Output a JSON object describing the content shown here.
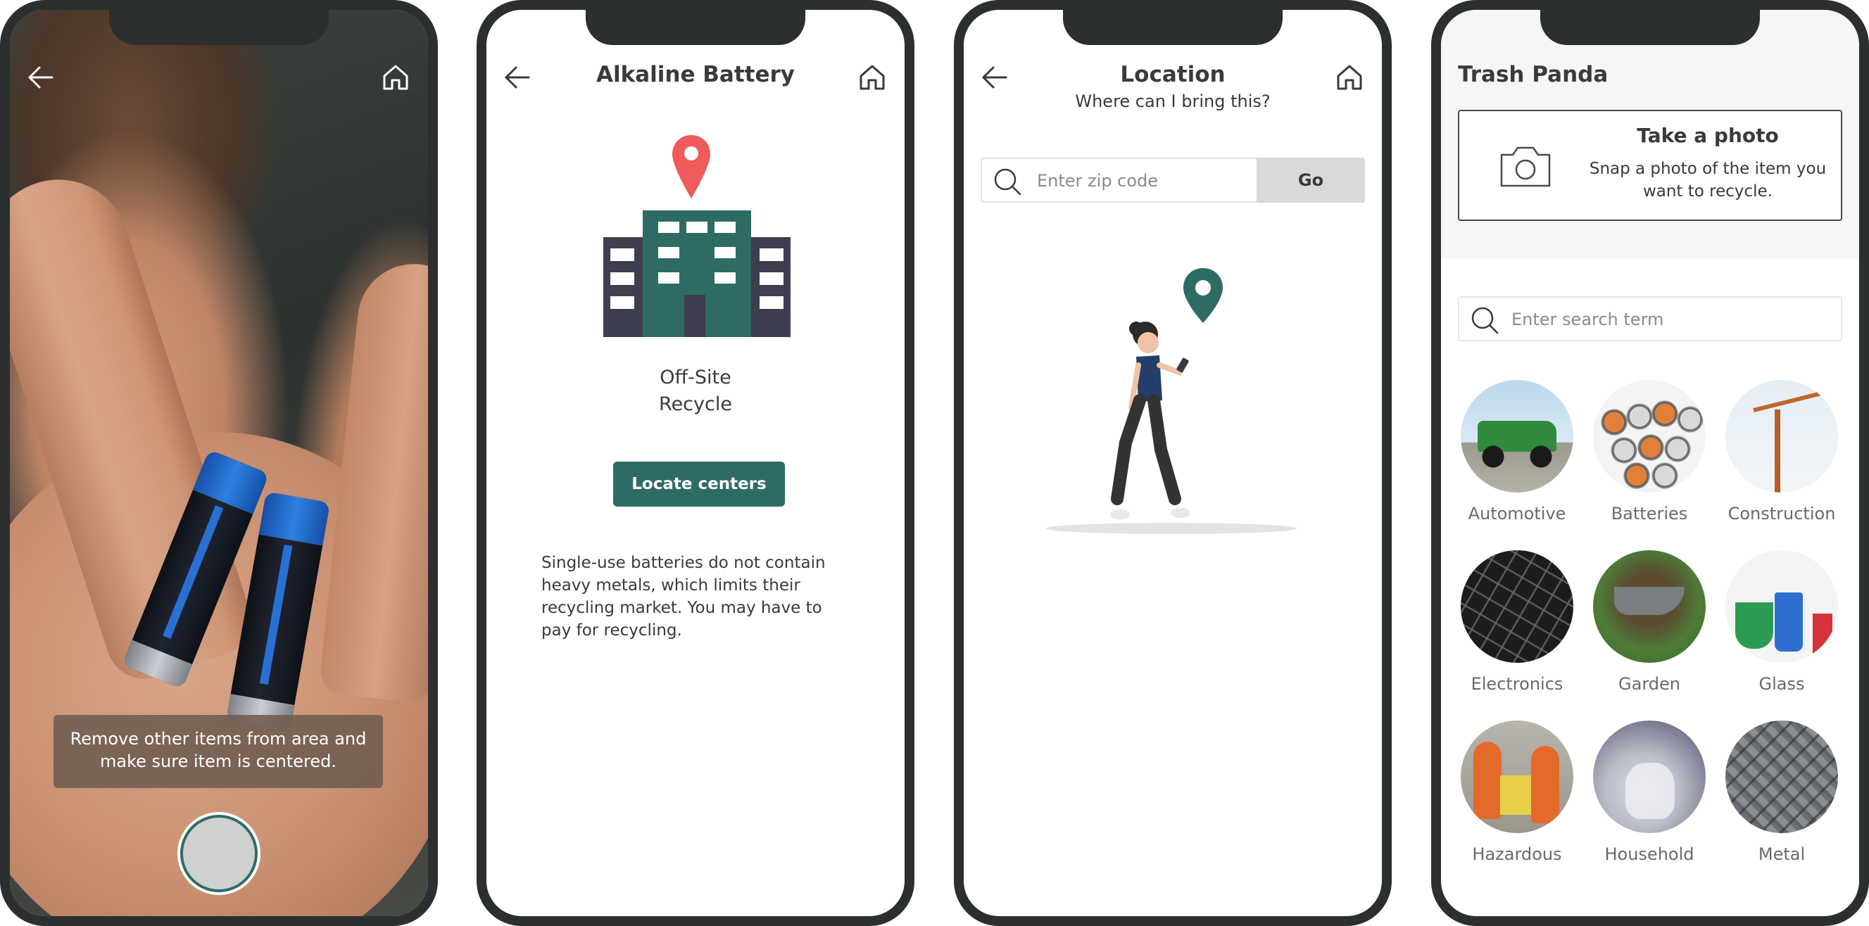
{
  "colors": {
    "frame": "#2b2f30",
    "accent": "#2f6b65",
    "pin_red": "#ef5a5a",
    "text": "#3a3a3a"
  },
  "camera_screen": {
    "hint": "Remove other items from area and make sure item is centered.",
    "icons": {
      "back": "back-arrow-icon",
      "home": "home-icon",
      "shutter": "shutter-button"
    }
  },
  "item_screen": {
    "title": "Alkaline Battery",
    "disposal_line1": "Off-Site",
    "disposal_line2": "Recycle",
    "locate_button": "Locate centers",
    "description": "Single-use batteries do not contain heavy metals, which limits their recycling market. You may have to pay for recycling.",
    "icons": {
      "pin": "location-pin-icon",
      "building": "building-icon"
    }
  },
  "location_screen": {
    "title": "Location",
    "subtitle": "Where can I bring this?",
    "zip_placeholder": "Enter zip code",
    "go_button": "Go"
  },
  "home_screen": {
    "app_title": "Trash Panda",
    "photo_card": {
      "title": "Take a photo",
      "subtitle": "Snap a photo of the item you want to recycle."
    },
    "search_placeholder": "Enter search term",
    "categories": [
      {
        "label": "Automotive",
        "thumb": "t-automotive"
      },
      {
        "label": "Batteries",
        "thumb": "t-batteries"
      },
      {
        "label": "Construction",
        "thumb": "t-construction"
      },
      {
        "label": "Electronics",
        "thumb": "t-electronics"
      },
      {
        "label": "Garden",
        "thumb": "t-garden"
      },
      {
        "label": "Glass",
        "thumb": "t-glass"
      },
      {
        "label": "Hazardous",
        "thumb": "t-hazardous"
      },
      {
        "label": "Household",
        "thumb": "t-household"
      },
      {
        "label": "Metal",
        "thumb": "t-metal"
      }
    ]
  }
}
